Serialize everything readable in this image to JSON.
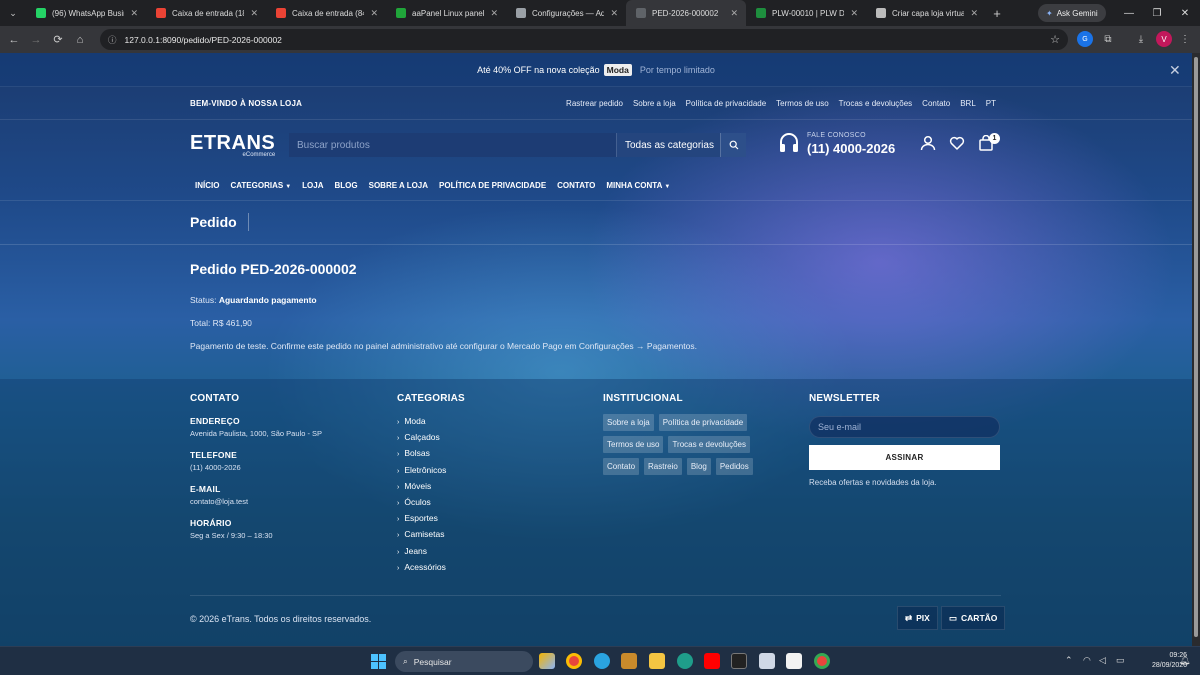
{
  "browser": {
    "tabs": [
      {
        "label": "(96) WhatsApp Busines",
        "color": "#25d366"
      },
      {
        "label": "Caixa de entrada (184",
        "color": "#ea4335"
      },
      {
        "label": "Caixa de entrada (841",
        "color": "#ea4335"
      },
      {
        "label": "aaPanel Linux panel - f",
        "color": "#20a53a"
      },
      {
        "label": "Configurações — Adm",
        "color": "#9aa0a6"
      },
      {
        "label": "PED-2026-000002",
        "color": "#5f6368",
        "active": true
      },
      {
        "label": "PLW-00010 | PLW Des",
        "color": "#1e8e3e"
      },
      {
        "label": "Criar capa loja virtual",
        "color": "#bbbbbb"
      }
    ],
    "ask_gemini": "Ask Gemini",
    "url": "127.0.0.1:8090/pedido/PED-2026-000002",
    "profile_initial": "V"
  },
  "promo": {
    "text_before": "Até 40% OFF na nova coleção",
    "tag": "Moda",
    "muted": "Por tempo limitado"
  },
  "topbar": {
    "welcome": "BEM-VINDO À NOSSA LOJA",
    "links": [
      "Rastrear pedido",
      "Sobre a loja",
      "Política de privacidade",
      "Termos de uso",
      "Trocas e devoluções",
      "Contato",
      "BRL",
      "PT"
    ]
  },
  "header": {
    "logo": "ETRANS",
    "logo_sub": "eCommerce",
    "search_placeholder": "Buscar produtos",
    "category_select": "Todas as categorias",
    "contact_label": "FALE CONOSCO",
    "contact_phone": "(11) 4000-2026",
    "cart_count": "1"
  },
  "nav": {
    "items": [
      {
        "label": "INÍCIO"
      },
      {
        "label": "CATEGORIAS",
        "dropdown": true
      },
      {
        "label": "LOJA"
      },
      {
        "label": "BLOG"
      },
      {
        "label": "SOBRE A LOJA"
      },
      {
        "label": "POLÍTICA DE PRIVACIDADE"
      },
      {
        "label": "CONTATO"
      },
      {
        "label": "MINHA CONTA",
        "dropdown": true
      }
    ]
  },
  "page_title": "Pedido",
  "order": {
    "title": "Pedido PED-2026-000002",
    "status_label": "Status:",
    "status_value": "Aguardando pagamento",
    "total": "Total: R$ 461,90",
    "note": "Pagamento de teste. Confirme este pedido no painel administrativo até configurar o Mercado Pago em Configurações → Pagamentos."
  },
  "footer": {
    "contact": {
      "heading": "CONTATO",
      "items": [
        {
          "k": "ENDEREÇO",
          "v": "Avenida Paulista, 1000, São Paulo - SP"
        },
        {
          "k": "TELEFONE",
          "v": "(11) 4000-2026"
        },
        {
          "k": "E-MAIL",
          "v": "contato@loja.test"
        },
        {
          "k": "HORÁRIO",
          "v": "Seg a Sex / 9:30 – 18:30"
        }
      ]
    },
    "categories": {
      "heading": "CATEGORIAS",
      "items": [
        "Moda",
        "Calçados",
        "Bolsas",
        "Eletrônicos",
        "Móveis",
        "Óculos",
        "Esportes",
        "Camisetas",
        "Jeans",
        "Acessórios"
      ]
    },
    "institutional": {
      "heading": "INSTITUCIONAL",
      "items": [
        "Sobre a loja",
        "Política de privacidade",
        "Termos de uso",
        "Trocas e devoluções",
        "Contato",
        "Rastreio",
        "Blog",
        "Pedidos"
      ]
    },
    "newsletter": {
      "heading": "NEWSLETTER",
      "placeholder": "Seu e-mail",
      "button": "ASSINAR",
      "hint": "Receba ofertas e novidades da loja."
    },
    "copyright": "© 2026 eTrans. Todos os direitos reservados.",
    "payments": [
      "PIX",
      "CARTÃO"
    ]
  },
  "taskbar": {
    "search_label": "Pesquisar",
    "time": "09:26",
    "date": "28/09/2026"
  }
}
